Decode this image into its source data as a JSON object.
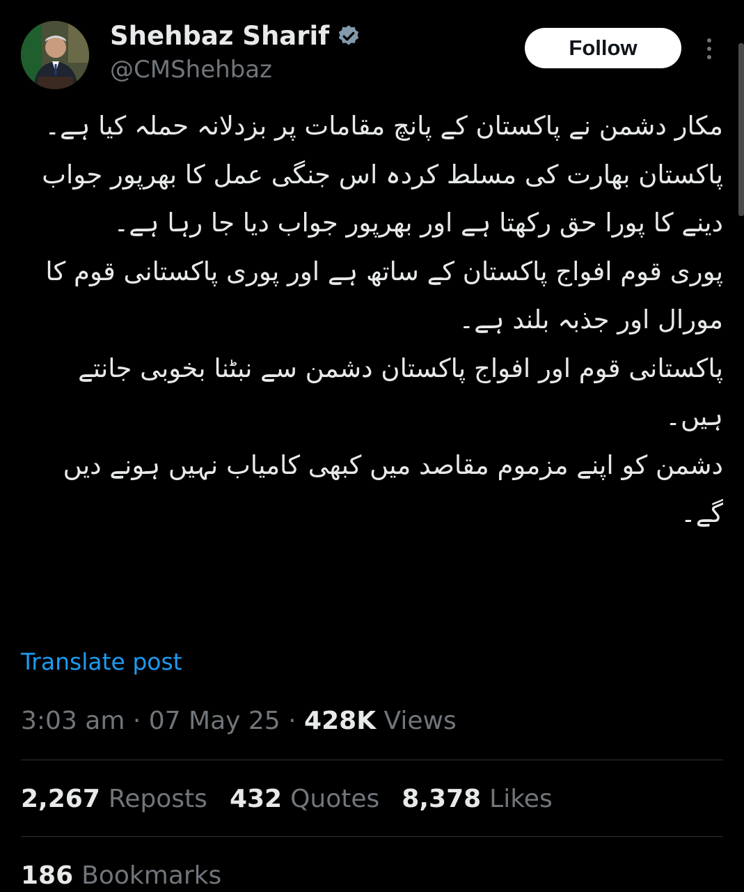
{
  "author": {
    "display_name": "Shehbaz Sharif",
    "handle": "@CMShehbaz",
    "verified_icon": "verified-badge-icon",
    "avatar_icon": "profile-photo"
  },
  "header": {
    "follow_label": "Follow",
    "more_icon": "more-vertical-icon"
  },
  "tweet": {
    "lines": [
      "مکار دشمن نے پاکستان کے پانچ مقامات پر بزدلانہ حملہ کیا ہے۔",
      "پاکستان بھارت کی مسلط کردہ اس جنگی عمل کا بھرپور جواب دینے کا پورا حق رکھتا ہے اور بھرپور جواب دیا جا رہا ہے۔",
      "پوری قوم افواج پاکستان کے ساتھ ہے اور پوری پاکستانی قوم کا مورال اور جذبہ بلند ہے۔",
      "پاکستانی قوم اور افواج پاکستان دشمن سے نبٹنا بخوبی جانتے ہیں۔",
      "دشمن کو اپنے مزموم مقاصد میں کبھی کامیاب نہیں ہونے دیں گے۔"
    ],
    "translate_label": "Translate post"
  },
  "meta": {
    "time": "3:03 am",
    "separator": " · ",
    "date": "07 May 25",
    "views_count": "428K",
    "views_label": "Views"
  },
  "stats": {
    "reposts_count": "2,267",
    "reposts_label": "Reposts",
    "quotes_count": "432",
    "quotes_label": "Quotes",
    "likes_count": "8,378",
    "likes_label": "Likes",
    "bookmarks_count": "186",
    "bookmarks_label": "Bookmarks"
  },
  "colors": {
    "background": "#000000",
    "text_primary": "#e7e9ea",
    "text_secondary": "#71767b",
    "link": "#1d9bf0",
    "divider": "#2f3336"
  }
}
